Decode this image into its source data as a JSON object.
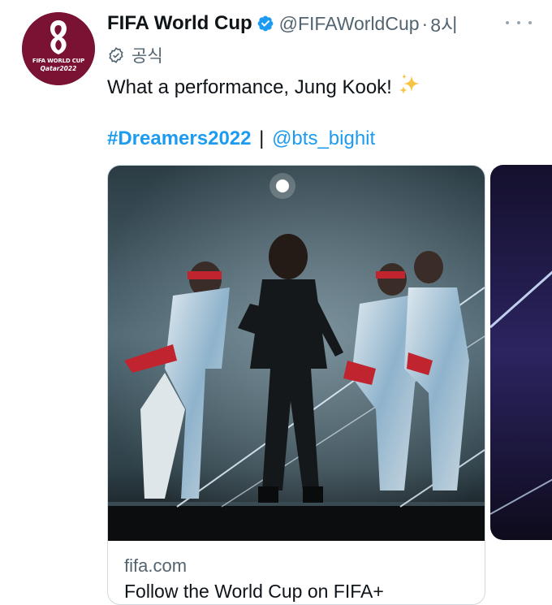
{
  "account": {
    "name": "FIFA World Cup",
    "handle": "@FIFAWorldCup",
    "separator": "·",
    "time": "8시",
    "official_label": "공식",
    "avatar": {
      "line1": "FIFA WORLD CUP",
      "line2": "Qatar2022"
    }
  },
  "tweet": {
    "text": "What a performance, Jung Kook!",
    "hashtag": "#Dreamers2022",
    "divider": "|",
    "mention": "@bts_bighit"
  },
  "cards": [
    {
      "domain": "fifa.com",
      "title": "Follow the World Cup on FIFA+"
    }
  ],
  "colors": {
    "link": "#1d9bf0",
    "verified": "#1d9bf0",
    "secondary_text": "#536471",
    "brand": "#7a1234"
  },
  "icons": [
    "verified-badge-icon",
    "official-badge-icon",
    "sparkles-icon",
    "more-icon"
  ]
}
